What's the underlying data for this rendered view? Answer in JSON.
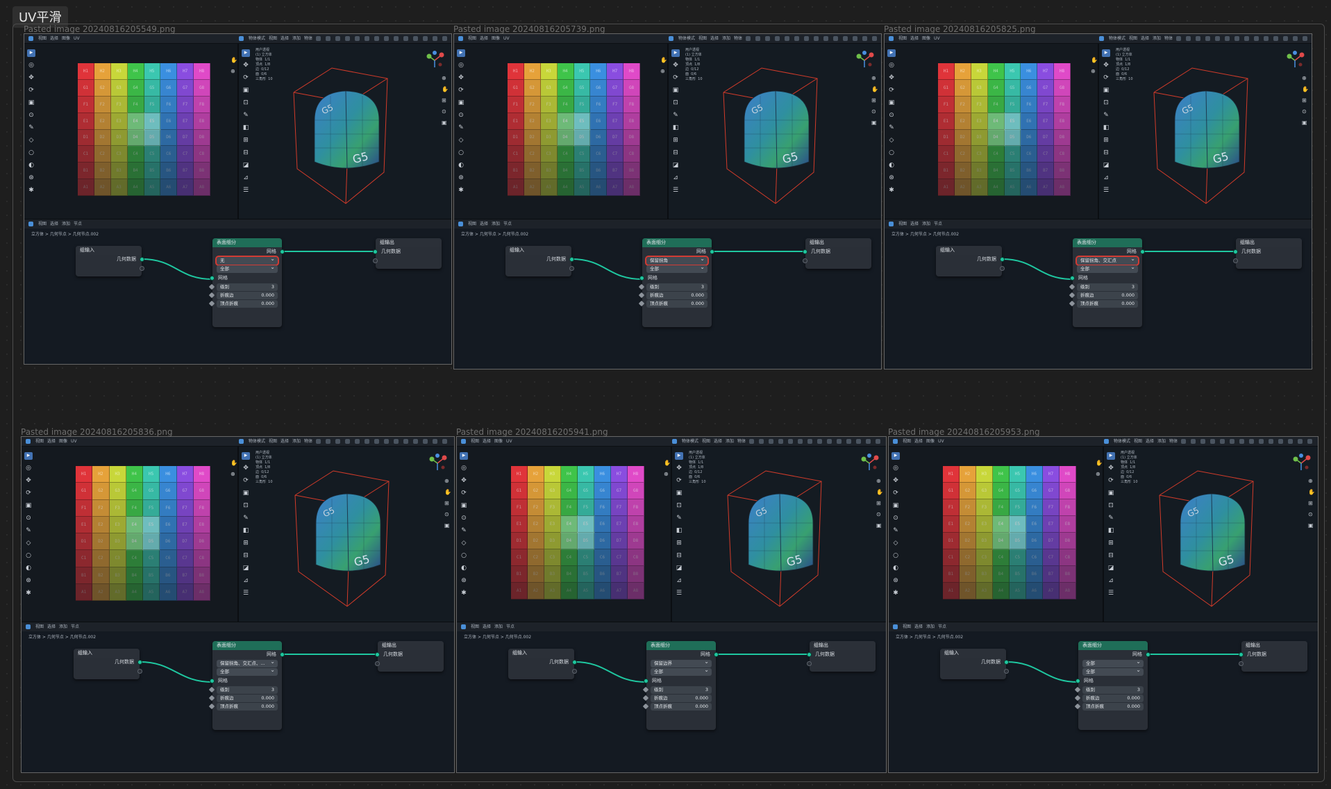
{
  "canvas": {
    "group_label": "UV平滑"
  },
  "cards": [
    {
      "caption": "Pasted image 20240816205549.png",
      "dropdown1": "无",
      "dropdown2": "全部",
      "highlight_dropdown": true
    },
    {
      "caption": "Pasted image 20240816205739.png",
      "dropdown1": "保留拐角",
      "dropdown2": "全部",
      "highlight_dropdown": true
    },
    {
      "caption": "Pasted image 20240816205825.png",
      "dropdown1": "保留拐角、交汇点",
      "dropdown2": "全部",
      "highlight_dropdown": true
    },
    {
      "caption": "Pasted image 20240816205836.png",
      "dropdown1": "保留拐角、交汇点、...",
      "dropdown2": "全部",
      "highlight_dropdown": false
    },
    {
      "caption": "Pasted image 20240816205941.png",
      "dropdown1": "保留边界",
      "dropdown2": "全部",
      "highlight_dropdown": false
    },
    {
      "caption": "Pasted image 20240816205953.png",
      "dropdown1": "全部",
      "dropdown2": "全部",
      "highlight_dropdown": false
    }
  ],
  "blender": {
    "menu_left": [
      "视图",
      "选择",
      "图像",
      "UV"
    ],
    "menu_mid": [
      "物体模式",
      "视图",
      "选择",
      "添加",
      "物体"
    ],
    "stats": "用户透视\n(1) 立方体\n物体  1/1\n顶点  1/8\n边  0/12\n面  0/6\n三角形  10",
    "node_menu": [
      "视图",
      "选择",
      "添加",
      "节点"
    ],
    "breadcrumb": "立方体  >  几何节点  >  几何节点.002",
    "nodes": {
      "group_input": {
        "title": "组输入",
        "output": "几何数据"
      },
      "group_output": {
        "title": "组输出",
        "input": "几何数据"
      },
      "subdivide": {
        "title": "表面细分",
        "out_mesh": "网格",
        "in_mesh": "网格",
        "level_label": "级别",
        "level_value": "3",
        "edge_crease_label": "折痕边",
        "edge_crease_value": "0.000",
        "vertex_crease_label": "顶点折痕",
        "vertex_crease_value": "0.000"
      }
    },
    "uv_rows": [
      "A",
      "B",
      "C",
      "D",
      "E",
      "F",
      "G",
      "H"
    ],
    "uv_cols": [
      "1",
      "2",
      "3",
      "4",
      "5",
      "6",
      "7",
      "8"
    ],
    "uv_colors": [
      "#e0343a",
      "#e6a23a",
      "#c8d73a",
      "#3fc44a",
      "#3bc7b0",
      "#3a8fe0",
      "#8a4de0",
      "#e04ac8"
    ],
    "face_label": "G5"
  }
}
